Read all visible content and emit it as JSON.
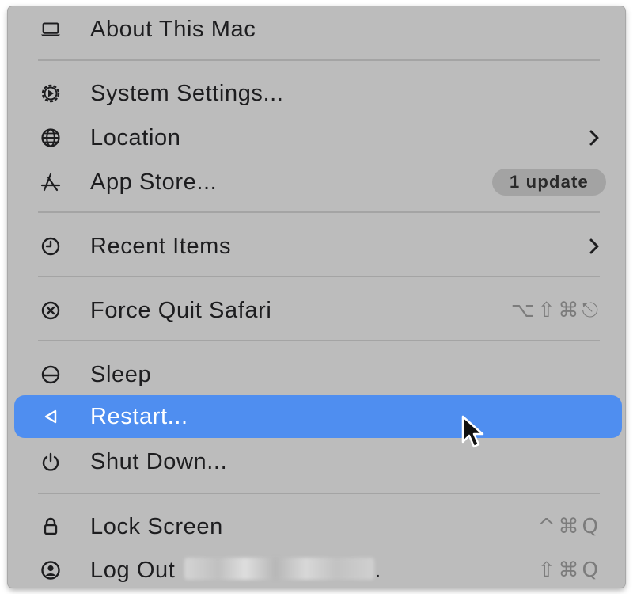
{
  "menu": {
    "items": [
      {
        "label": "About This Mac",
        "icon": "laptop-icon"
      },
      {
        "label": "System Settings...",
        "icon": "gear-icon"
      },
      {
        "label": "Location",
        "icon": "globe-icon",
        "submenu": true
      },
      {
        "label": "App Store...",
        "icon": "app-store-icon",
        "badge": "1 update"
      },
      {
        "label": "Recent Items",
        "icon": "clock-icon",
        "submenu": true
      },
      {
        "label": "Force Quit Safari",
        "icon": "force-quit-icon",
        "shortcut": "⌥⇧⌘⎋"
      },
      {
        "label": "Sleep",
        "icon": "sleep-icon"
      },
      {
        "label": "Restart...",
        "icon": "restart-icon",
        "highlighted": true
      },
      {
        "label": "Shut Down...",
        "icon": "power-icon"
      },
      {
        "label": "Lock Screen",
        "icon": "lock-icon",
        "shortcut": "^⌘Q"
      },
      {
        "label": "Log Out",
        "icon": "user-icon",
        "shortcut": "⇧⌘Q",
        "redacted_suffix": "."
      }
    ]
  },
  "colors": {
    "menu_background": "#bcbcbc",
    "highlight": "#4f8ef0",
    "text": "#1d1d1f",
    "shortcut_text": "#7c7c7c",
    "badge_background": "#a3a3a3",
    "separator": "#a4a4a4"
  }
}
